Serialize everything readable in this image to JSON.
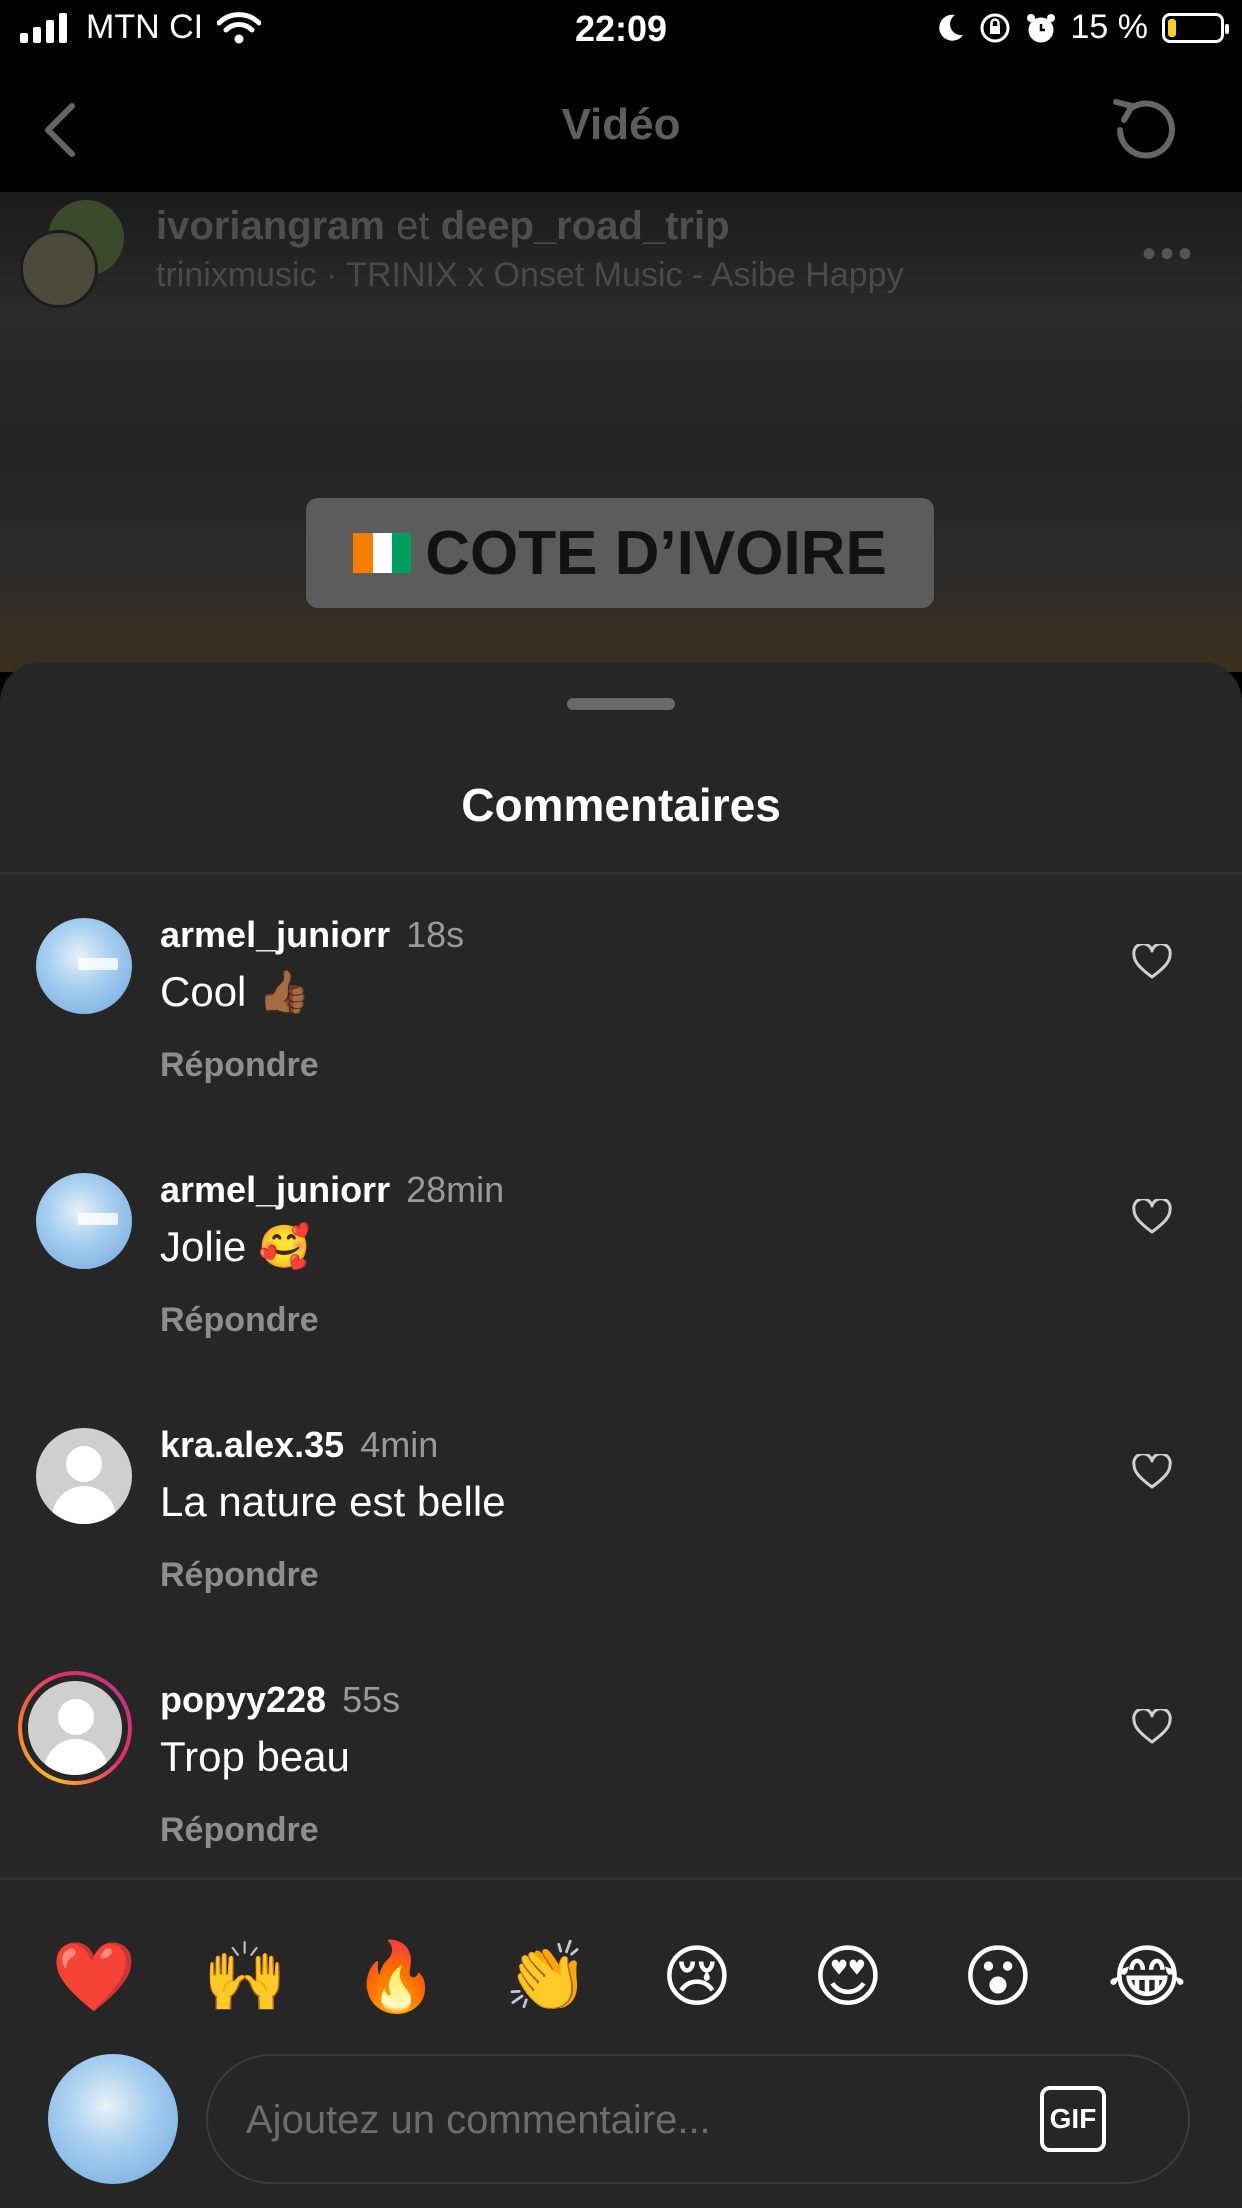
{
  "status_bar": {
    "carrier": "MTN CI",
    "time": "22:09",
    "battery_percent": "15 %",
    "battery_level": 0.15,
    "icons": [
      "signal-icon",
      "wifi-icon",
      "moon-icon",
      "orientation-lock-icon",
      "alarm-icon",
      "battery-icon"
    ]
  },
  "nav": {
    "title": "Vidéo",
    "back_icon": "chevron-left-icon",
    "refresh_icon": "refresh-icon"
  },
  "post": {
    "user1": "ivoriangram",
    "joiner": "et",
    "user2": "deep_road_trip",
    "audio": "trinixmusic · TRINIX x Onset Music - Asibe Happy",
    "more": "•••",
    "banner_text": "COTE D’IVOIRE",
    "banner_flag_colors": [
      "#f77f00",
      "#ffffff",
      "#009e60"
    ]
  },
  "sheet": {
    "title": "Commentaires"
  },
  "comments": [
    {
      "username": "armel_juniorr",
      "time": "18s",
      "text": "Cool 👍🏾",
      "reply": "Répondre"
    },
    {
      "username": "armel_juniorr",
      "time": "28min",
      "text": "Jolie 🥰",
      "reply": "Répondre"
    },
    {
      "username": "kra.alex.35",
      "time": "4min",
      "text": "La nature est belle",
      "reply": "Répondre"
    },
    {
      "username": "popyy228",
      "time": "55s",
      "text": "Trop beau",
      "reply": "Répondre"
    }
  ],
  "reactions": [
    "❤️",
    "🙌",
    "🔥",
    "👏",
    "😢",
    "😍",
    "😮",
    "😂"
  ],
  "composer": {
    "placeholder": "Ajoutez un commentaire...",
    "gif_label": "GIF"
  }
}
